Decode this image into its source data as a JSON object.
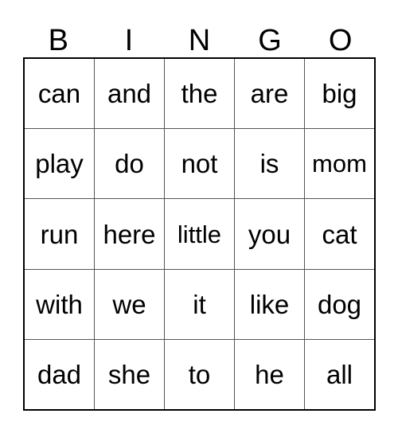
{
  "card": {
    "header": {
      "letters": [
        "B",
        "I",
        "N",
        "G",
        "O"
      ]
    },
    "grid": {
      "rows": [
        {
          "cells": [
            "can",
            "and",
            "the",
            "are",
            "big"
          ]
        },
        {
          "cells": [
            "play",
            "do",
            "not",
            "is",
            "mom"
          ]
        },
        {
          "cells": [
            "run",
            "here",
            "little",
            "you",
            "cat"
          ]
        },
        {
          "cells": [
            "with",
            "we",
            "it",
            "like",
            "dog"
          ]
        },
        {
          "cells": [
            "dad",
            "she",
            "to",
            "he",
            "all"
          ]
        }
      ]
    },
    "colors": {
      "text": "#000000",
      "background": "#ffffff",
      "outer_border": "#000000",
      "inner_grid_line": "#555555"
    }
  }
}
